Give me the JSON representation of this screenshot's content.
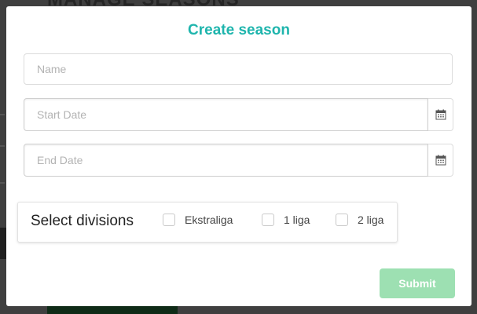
{
  "background": {
    "partial_title": "MANAGE SEASONS"
  },
  "modal": {
    "title": "Create season",
    "name_field": {
      "placeholder": "Name",
      "value": ""
    },
    "start_date": {
      "placeholder": "Start Date",
      "value": "",
      "icon": "calendar-icon"
    },
    "end_date": {
      "placeholder": "End Date",
      "value": "",
      "icon": "calendar-icon"
    },
    "divisions": {
      "label": "Select divisions",
      "options": [
        {
          "label": "Ekstraliga",
          "checked": false
        },
        {
          "label": "1 liga",
          "checked": false
        },
        {
          "label": "2 liga",
          "checked": false
        }
      ]
    },
    "submit_label": "Submit"
  },
  "colors": {
    "title": "#1fb5ad",
    "submit_bg": "#9de0b2",
    "overlay": "#3f3f3f"
  }
}
